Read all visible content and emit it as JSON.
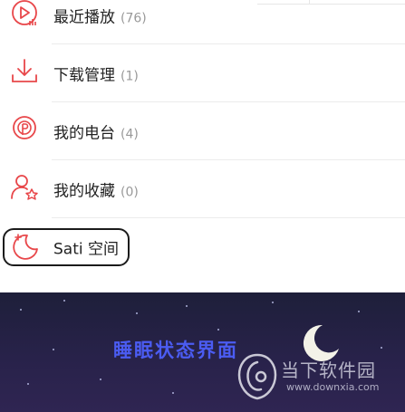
{
  "menu": {
    "items": [
      {
        "label": "最近播放",
        "count": "(76)",
        "icon": "recent-play-icon"
      },
      {
        "label": "下载管理",
        "count": "(1)",
        "icon": "download-icon"
      },
      {
        "label": "我的电台",
        "count": "(4)",
        "icon": "radio-icon"
      },
      {
        "label": "我的收藏",
        "count": "(0)",
        "icon": "favorites-icon"
      },
      {
        "label": "Sati 空间",
        "count": "",
        "icon": "sati-moon-icon"
      }
    ]
  },
  "sleep_panel": {
    "title": "睡眠状态界面"
  },
  "watermark": {
    "text": "当下软件园",
    "url": "www.downxia.com"
  },
  "colors": {
    "accent": "#e8474a",
    "title_blue": "#4b5cf2",
    "night_bg": "#26223f"
  }
}
